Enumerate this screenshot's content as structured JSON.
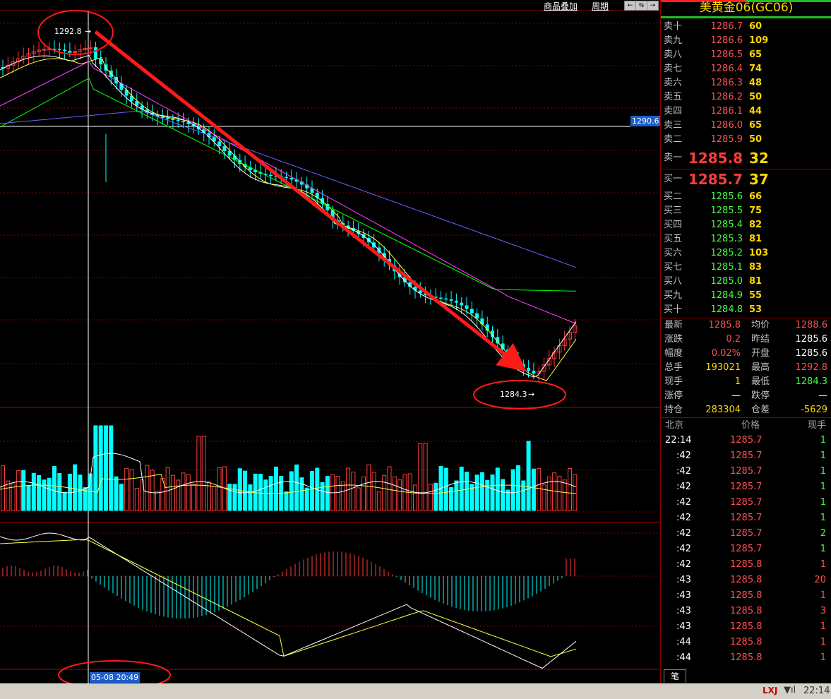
{
  "toolbar": {
    "overlay_label": "商品叠加",
    "period_label": "周期",
    "nav_buttons": [
      "←",
      "⇆",
      "→",
      "↑"
    ]
  },
  "chart": {
    "high_label": "1292.8",
    "low_label": "1284.3",
    "crosshair_price": "1290.6",
    "crosshair_time": "05-08 20:49"
  },
  "chart_data": {
    "type": "candlestick",
    "price_high": 1292.8,
    "price_low": 1284.3,
    "crosshair_price": 1290.6,
    "crosshair_time": "05-08 20:49",
    "colors": {
      "up": "#ff3c3c",
      "down": "#00ffff",
      "ma5": "#ffffff",
      "ma10": "#ffff40",
      "ma20": "#ff40ff",
      "ma30": "#00ff00",
      "ma60": "#6464ff",
      "trend_arrow": "#ff1a1a",
      "annotation_ellipse": "#ff1a1a"
    }
  },
  "panel": {
    "title": "美黄金06(GC06)",
    "asks": [
      {
        "label": "卖十",
        "price": "1286.7",
        "vol": "60"
      },
      {
        "label": "卖九",
        "price": "1286.6",
        "vol": "109"
      },
      {
        "label": "卖八",
        "price": "1286.5",
        "vol": "65"
      },
      {
        "label": "卖七",
        "price": "1286.4",
        "vol": "74"
      },
      {
        "label": "卖六",
        "price": "1286.3",
        "vol": "48"
      },
      {
        "label": "卖五",
        "price": "1286.2",
        "vol": "50"
      },
      {
        "label": "卖四",
        "price": "1286.1",
        "vol": "44"
      },
      {
        "label": "卖三",
        "price": "1286.0",
        "vol": "65"
      },
      {
        "label": "卖二",
        "price": "1285.9",
        "vol": "50"
      }
    ],
    "ask1": {
      "label": "卖一",
      "price": "1285.8",
      "vol": "32"
    },
    "bid1": {
      "label": "买一",
      "price": "1285.7",
      "vol": "37"
    },
    "bids": [
      {
        "label": "买二",
        "price": "1285.6",
        "vol": "66"
      },
      {
        "label": "买三",
        "price": "1285.5",
        "vol": "75"
      },
      {
        "label": "买四",
        "price": "1285.4",
        "vol": "82"
      },
      {
        "label": "买五",
        "price": "1285.3",
        "vol": "81"
      },
      {
        "label": "买六",
        "price": "1285.2",
        "vol": "103"
      },
      {
        "label": "买七",
        "price": "1285.1",
        "vol": "83"
      },
      {
        "label": "买八",
        "price": "1285.0",
        "vol": "81"
      },
      {
        "label": "买九",
        "price": "1284.9",
        "vol": "55"
      },
      {
        "label": "买十",
        "price": "1284.8",
        "vol": "53"
      }
    ],
    "quote": [
      {
        "l1": "最新",
        "v1": "1285.8",
        "c1": "#ff5050",
        "l2": "均价",
        "v2": "1288.6",
        "c2": "#ff5050"
      },
      {
        "l1": "涨跌",
        "v1": "0.2",
        "c1": "#ff5050",
        "l2": "昨结",
        "v2": "1285.6",
        "c2": "#ffffff"
      },
      {
        "l1": "幅度",
        "v1": "0.02%",
        "c1": "#ff5050",
        "l2": "开盘",
        "v2": "1285.6",
        "c2": "#ffffff"
      },
      {
        "l1": "总手",
        "v1": "193021",
        "c1": "#ffd800",
        "l2": "最高",
        "v2": "1292.8",
        "c2": "#ff5050"
      },
      {
        "l1": "现手",
        "v1": "1",
        "c1": "#ffd800",
        "l2": "最低",
        "v2": "1284.3",
        "c2": "#40ff40"
      },
      {
        "l1": "涨停",
        "v1": "—",
        "c1": "#ffffff",
        "l2": "跌停",
        "v2": "—",
        "c2": "#ffffff"
      },
      {
        "l1": "持仓",
        "v1": "283304",
        "c1": "#ffd800",
        "l2": "仓差",
        "v2": "-5629",
        "c2": "#ffd800"
      }
    ],
    "ticks_header": {
      "time": "北京",
      "price": "价格",
      "vol": "现手"
    },
    "ticks": [
      {
        "t": "22:14",
        "p": "1285.7",
        "v": "1",
        "vc": "#40ff40"
      },
      {
        "t": ":42",
        "p": "1285.7",
        "v": "1",
        "vc": "#40ff40"
      },
      {
        "t": ":42",
        "p": "1285.7",
        "v": "1",
        "vc": "#40ff40"
      },
      {
        "t": ":42",
        "p": "1285.7",
        "v": "1",
        "vc": "#40ff40"
      },
      {
        "t": ":42",
        "p": "1285.7",
        "v": "1",
        "vc": "#40ff40"
      },
      {
        "t": ":42",
        "p": "1285.7",
        "v": "1",
        "vc": "#40ff40"
      },
      {
        "t": ":42",
        "p": "1285.7",
        "v": "2",
        "vc": "#40ff40"
      },
      {
        "t": ":42",
        "p": "1285.7",
        "v": "1",
        "vc": "#40ff40"
      },
      {
        "t": ":42",
        "p": "1285.8",
        "v": "1",
        "vc": "#ff5050"
      },
      {
        "t": ":43",
        "p": "1285.8",
        "v": "20",
        "vc": "#ff5050"
      },
      {
        "t": ":43",
        "p": "1285.8",
        "v": "1",
        "vc": "#ff5050"
      },
      {
        "t": ":43",
        "p": "1285.8",
        "v": "3",
        "vc": "#ff5050"
      },
      {
        "t": ":43",
        "p": "1285.8",
        "v": "1",
        "vc": "#ff5050"
      },
      {
        "t": ":44",
        "p": "1285.8",
        "v": "1",
        "vc": "#ff5050"
      },
      {
        "t": ":44",
        "p": "1285.8",
        "v": "1",
        "vc": "#ff5050"
      }
    ],
    "tab_label": "笔"
  },
  "status": {
    "logo": "LXJ",
    "clock": "22:14"
  }
}
